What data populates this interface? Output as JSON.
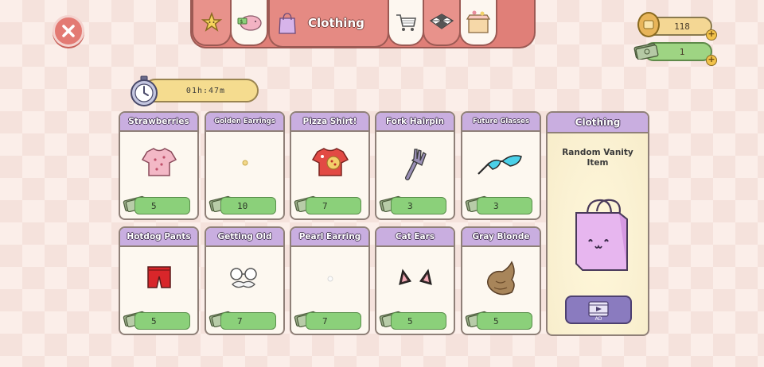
{
  "header": {
    "tabs": [
      {
        "icon": "star-icon"
      },
      {
        "icon": "piggy-bank-icon"
      },
      {
        "icon": "shopping-bag-icon",
        "label": "Clothing"
      },
      {
        "icon": "shopping-cart-icon"
      },
      {
        "icon": "tiles-icon"
      },
      {
        "icon": "gift-box-icon"
      }
    ]
  },
  "currency": {
    "coins": "118",
    "cash": "1"
  },
  "timer": {
    "value": "01h:47m"
  },
  "items": [
    {
      "name": "Strawberries",
      "price": "5",
      "icon": "strawberry-shirt-icon"
    },
    {
      "name": "Golden Earrings",
      "price": "10",
      "icon": "golden-earring-icon"
    },
    {
      "name": "Pizza Shirt!",
      "price": "7",
      "icon": "pizza-shirt-icon"
    },
    {
      "name": "Fork Hairpin",
      "price": "3",
      "icon": "fork-hairpin-icon"
    },
    {
      "name": "Future Glasses",
      "price": "3",
      "icon": "glasses-icon"
    },
    {
      "name": "Hotdog Pants",
      "price": "5",
      "icon": "pants-icon"
    },
    {
      "name": "Getting Old",
      "price": "7",
      "icon": "mustache-glasses-icon"
    },
    {
      "name": "Pearl Earring",
      "price": "7",
      "icon": "pearl-earring-icon"
    },
    {
      "name": "Cat Ears",
      "price": "5",
      "icon": "cat-ears-icon"
    },
    {
      "name": "Gray Blonde",
      "price": "5",
      "icon": "hair-icon"
    }
  ],
  "feature": {
    "title": "Clothing",
    "description_line1": "Random Vanity",
    "description_line2": "Item",
    "ad_label": "AD"
  },
  "colors": {
    "header_purple": "#c9aee0",
    "price_green": "#8bd07a",
    "tab_red": "#e07f78"
  }
}
